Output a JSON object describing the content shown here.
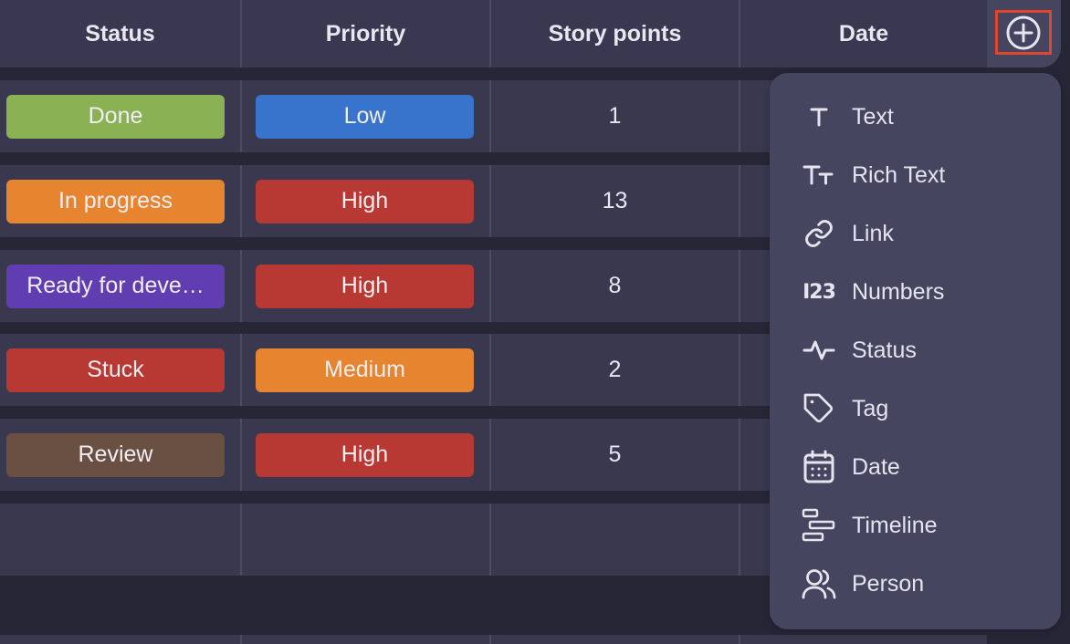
{
  "columns": [
    {
      "label": "Status"
    },
    {
      "label": "Priority"
    },
    {
      "label": "Story points"
    },
    {
      "label": "Date"
    }
  ],
  "add_column": {
    "icon": "plus-circle-icon",
    "highlight_color": "#e2452e"
  },
  "rows": [
    {
      "status": "Done",
      "status_color": "#8ab255",
      "priority": "Low",
      "priority_color": "#3874cc",
      "story_points": "1"
    },
    {
      "status": "In progress",
      "status_color": "#e68430",
      "priority": "High",
      "priority_color": "#b83933",
      "story_points": "13"
    },
    {
      "status": "Ready for deve…",
      "status_color": "#603eb1",
      "priority": "High",
      "priority_color": "#b83933",
      "story_points": "8"
    },
    {
      "status": "Stuck",
      "status_color": "#b83933",
      "priority": "Medium",
      "priority_color": "#e68430",
      "story_points": "2"
    },
    {
      "status": "Review",
      "status_color": "#6a4f43",
      "priority": "High",
      "priority_color": "#b83933",
      "story_points": "5"
    },
    {
      "status": "",
      "status_color": "",
      "priority": "",
      "priority_color": "",
      "story_points": ""
    }
  ],
  "column_type_menu": {
    "items": [
      {
        "label": "Text",
        "icon": "text-icon"
      },
      {
        "label": "Rich Text",
        "icon": "rich-text-icon"
      },
      {
        "label": "Link",
        "icon": "link-icon"
      },
      {
        "label": "Numbers",
        "icon": "numbers-icon"
      },
      {
        "label": "Status",
        "icon": "status-pulse-icon"
      },
      {
        "label": "Tag",
        "icon": "tag-icon"
      },
      {
        "label": "Date",
        "icon": "calendar-icon"
      },
      {
        "label": "Timeline",
        "icon": "timeline-icon"
      },
      {
        "label": "Person",
        "icon": "person-icon"
      }
    ]
  },
  "colors": {
    "background": "#272637",
    "cell": "#39384f",
    "menu": "#46455f"
  }
}
